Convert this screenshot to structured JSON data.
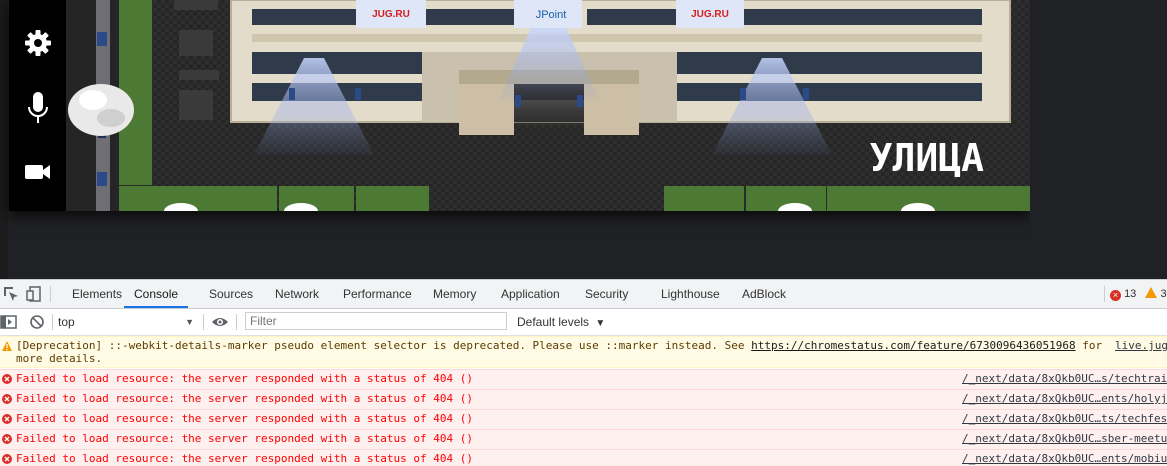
{
  "game": {
    "building_sign": "JPoint",
    "banner_left": "JUG.RU",
    "banner_right": "JUG.RU",
    "zone_label": "УЛИЦА",
    "colors": {
      "grass": "#4c7a34",
      "ground": "#262626",
      "building": "#e3dccb",
      "glass": "#2f3a4a"
    }
  },
  "side_controls": {
    "items": [
      {
        "icon": "gear-icon"
      },
      {
        "icon": "microphone-icon"
      },
      {
        "icon": "camera-icon"
      }
    ]
  },
  "devtools": {
    "tabs": [
      "Elements",
      "Console",
      "Sources",
      "Network",
      "Performance",
      "Memory",
      "Application",
      "Security",
      "Lighthouse",
      "AdBlock"
    ],
    "active_tab": "Console",
    "error_count": "13",
    "warning_count": "3",
    "context": "top",
    "filter_placeholder": "Filter",
    "levels": "Default levels",
    "messages": [
      {
        "level": "warning",
        "text": "[Deprecation] ::-webkit-details-marker pseudo element selector is deprecated. Please use ::marker instead. See",
        "link": "https://chromestatus.com/feature/6730096436051968",
        "suffix": "for",
        "line2": "more details.",
        "source": "live.jug"
      },
      {
        "level": "error",
        "text": "Failed to load resource: the server responded with a status of 404 ()",
        "source": "/_next/data/8xQkb0UC…s/techtrai"
      },
      {
        "level": "error",
        "text": "Failed to load resource: the server responded with a status of 404 ()",
        "source": "/_next/data/8xQkb0UC…ents/holyj"
      },
      {
        "level": "error",
        "text": "Failed to load resource: the server responded with a status of 404 ()",
        "source": "/_next/data/8xQkb0UC…ts/techfes"
      },
      {
        "level": "error",
        "text": "Failed to load resource: the server responded with a status of 404 ()",
        "source": "/_next/data/8xQkb0UC…sber-meetu"
      },
      {
        "level": "error",
        "text": "Failed to load resource: the server responded with a status of 404 ()",
        "source": "/_next/data/8xQkb0UC…ents/mobiu"
      }
    ]
  }
}
